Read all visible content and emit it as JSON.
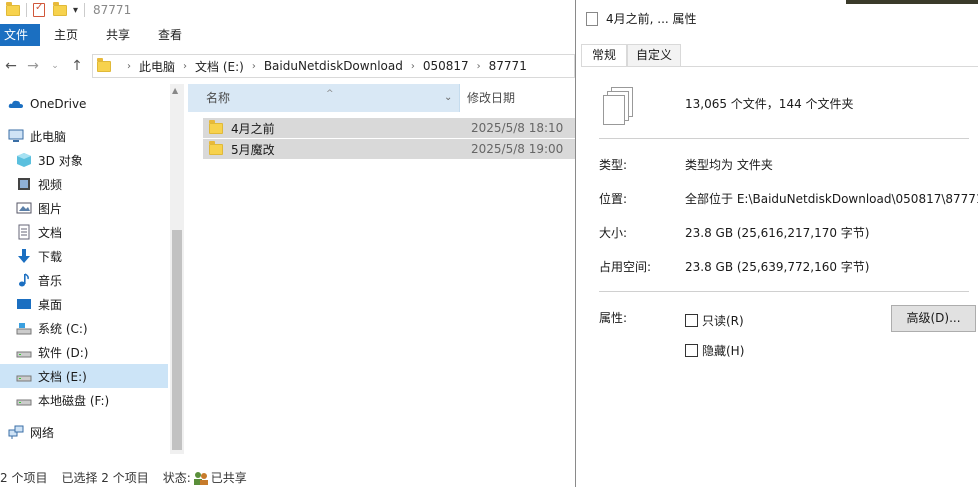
{
  "explorer": {
    "window_title": "87771",
    "ribbon_tabs": [
      "文件",
      "主页",
      "共享",
      "查看"
    ],
    "breadcrumb": [
      "此电脑",
      "文档 (E:)",
      "BaiduNetdiskDownload",
      "050817",
      "87771"
    ],
    "nav_items": [
      {
        "label": "OneDrive",
        "icon": "cloud-icon"
      },
      {
        "label": "此电脑",
        "icon": "computer-icon"
      },
      {
        "label": "3D 对象",
        "icon": "cube-icon"
      },
      {
        "label": "视频",
        "icon": "video-icon"
      },
      {
        "label": "图片",
        "icon": "picture-icon"
      },
      {
        "label": "文档",
        "icon": "document-icon"
      },
      {
        "label": "下载",
        "icon": "download-icon"
      },
      {
        "label": "音乐",
        "icon": "music-icon"
      },
      {
        "label": "桌面",
        "icon": "desktop-icon"
      },
      {
        "label": "系统 (C:)",
        "icon": "drive-icon"
      },
      {
        "label": "软件 (D:)",
        "icon": "drive-icon"
      },
      {
        "label": "文档 (E:)",
        "icon": "drive-icon"
      },
      {
        "label": "本地磁盘 (F:)",
        "icon": "drive-icon"
      },
      {
        "label": "网络",
        "icon": "network-icon"
      }
    ],
    "columns": {
      "name": "名称",
      "date": "修改日期"
    },
    "files": [
      {
        "name": "4月之前",
        "date": "2025/5/8 18:10"
      },
      {
        "name": "5月魔改",
        "date": "2025/5/8 19:00"
      }
    ],
    "status": {
      "count": "2 个项目",
      "selected": "已选择 2 个项目",
      "state": "状态:",
      "shared": "已共享"
    }
  },
  "properties": {
    "title": "4月之前, ... 属性",
    "tabs": [
      "常规",
      "自定义"
    ],
    "summary": "13,065 个文件，144 个文件夹",
    "type_label": "类型:",
    "type_value": "类型均为 文件夹",
    "location_label": "位置:",
    "location_value": "全部位于 E:\\BaiduNetdiskDownload\\050817\\87771",
    "size_label": "大小:",
    "size_value": "23.8 GB (25,616,217,170 字节)",
    "disk_label": "占用空间:",
    "disk_value": "23.8 GB (25,639,772,160 字节)",
    "attr_label": "属性:",
    "readonly_label": "只读(R)",
    "hidden_label": "隐藏(H)",
    "advanced_label": "高级(D)..."
  },
  "colors": {
    "accent": "#1b6fc1",
    "selection": "#cce4f7",
    "header": "#d9e8f5"
  }
}
